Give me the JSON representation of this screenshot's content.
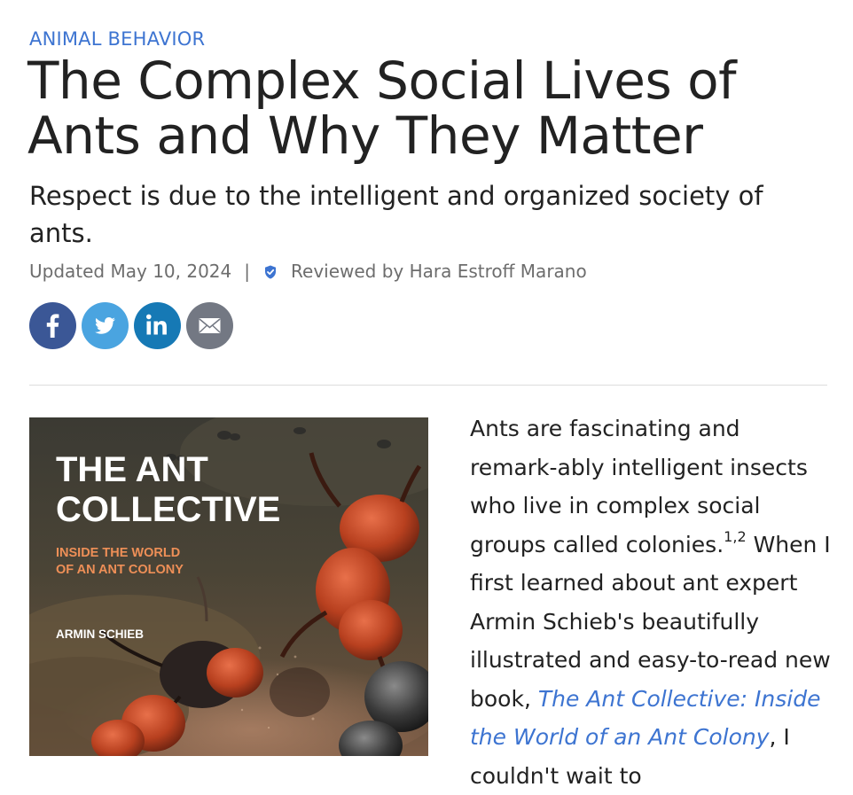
{
  "article": {
    "category": "ANIMAL BEHAVIOR",
    "title": "The Complex Social Lives of Ants and Why They Matter",
    "subtitle": "Respect is due to the intelligent and organized society of ants.",
    "updated": "Updated May 10, 2024",
    "separator": "|",
    "reviewed_by": "Reviewed by Hara Estroff Marano"
  },
  "share": {
    "facebook_icon": "facebook-icon",
    "twitter_icon": "twitter-icon",
    "linkedin_icon": "linkedin-icon",
    "email_icon": "email-icon"
  },
  "book_cover": {
    "title_line1": "THE ANT",
    "title_line2": "COLLECTIVE",
    "subtitle_line1": "INSIDE THE WORLD",
    "subtitle_line2": "OF AN ANT COLONY",
    "author": "ARMIN SCHIEB"
  },
  "body": {
    "para_start": "Ants are fascinating and remark-ably intelligent insects who live in complex social groups called colonies.",
    "citation": "1,2",
    "para_mid": " When I first learned about ant expert Armin Schieb's beautifully illustrated and easy-to-read new book, ",
    "book_link": "The Ant Collective: Inside the World of an Ant Colony",
    "para_end": ", I couldn't wait to"
  },
  "colors": {
    "accent": "#3d74d1",
    "facebook": "#3b5796",
    "twitter": "#4aa4e0",
    "linkedin": "#1679b5",
    "email": "#737883"
  }
}
